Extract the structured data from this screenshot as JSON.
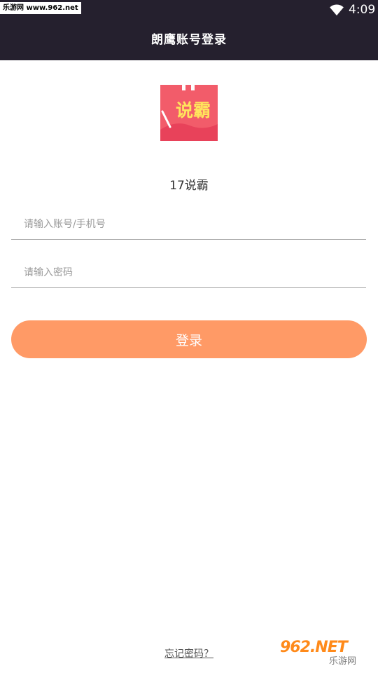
{
  "status_bar": {
    "watermark_text": "乐游网 www.962.net",
    "time": "4:09"
  },
  "header": {
    "title": "朗鹰账号登录"
  },
  "app": {
    "logo_text": "说霸",
    "name": "17说霸"
  },
  "form": {
    "account_placeholder": "请输入账号/手机号",
    "account_value": "",
    "password_placeholder": "请输入密码",
    "password_value": "",
    "login_label": "登录",
    "forgot_label": "忘记密码？"
  },
  "watermark": {
    "top": "962.NET",
    "bottom": "乐游网"
  },
  "colors": {
    "header_bg": "#25202e",
    "accent": "#ff9a66",
    "logo_red": "#f25c6a"
  }
}
